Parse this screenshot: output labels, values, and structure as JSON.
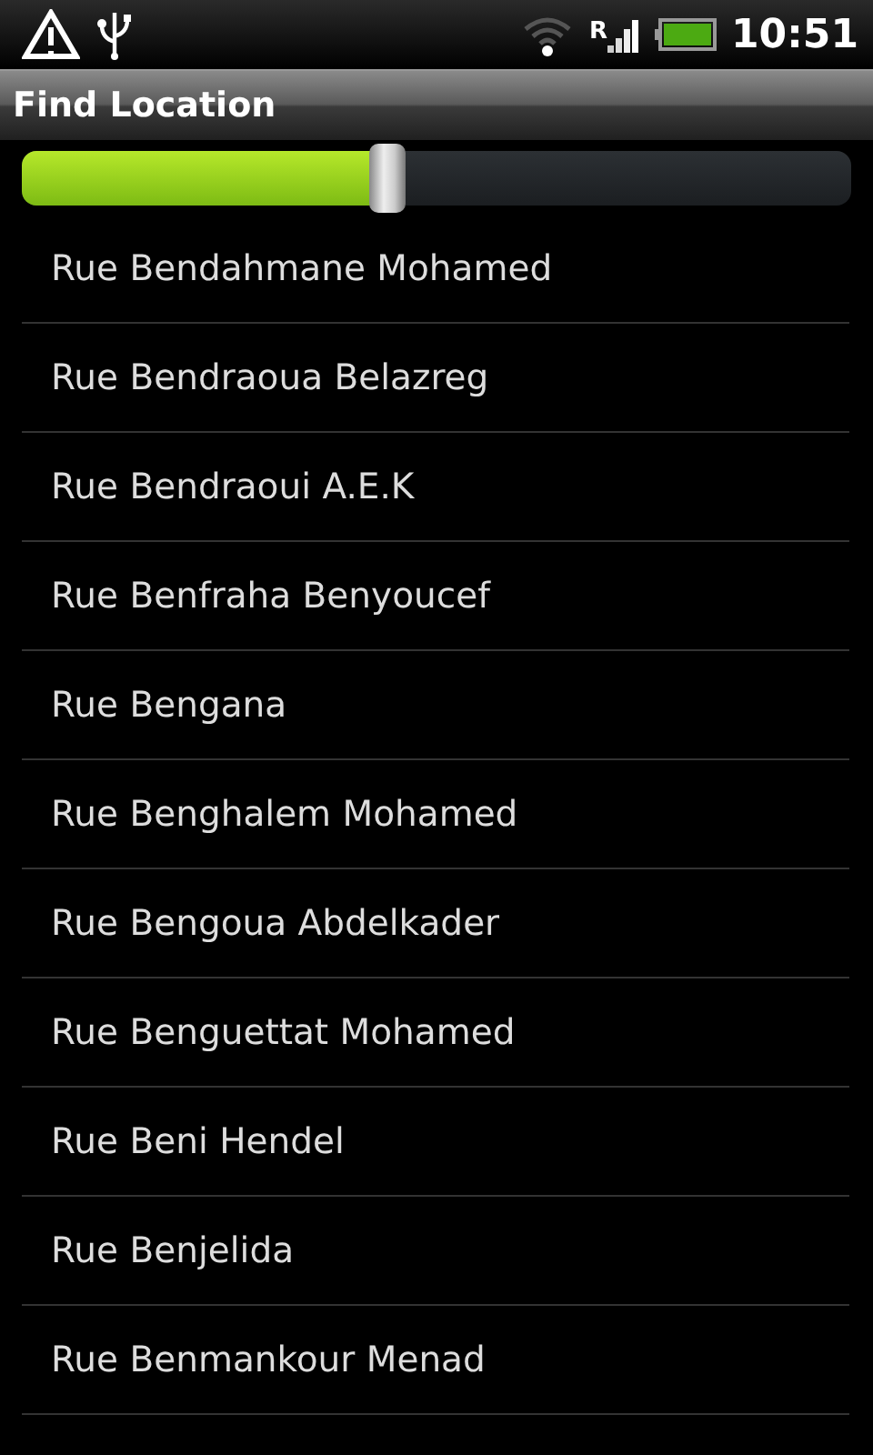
{
  "status_bar": {
    "roaming": "R",
    "time": "10:51"
  },
  "title_bar": {
    "title": "Find Location"
  },
  "slider": {
    "level": 0.44
  },
  "locations": [
    {
      "name": "Rue Bendahmane Mohamed"
    },
    {
      "name": "Rue Bendraoua Belazreg"
    },
    {
      "name": "Rue Bendraoui A.E.K"
    },
    {
      "name": "Rue Benfraha Benyoucef"
    },
    {
      "name": "Rue Bengana"
    },
    {
      "name": "Rue Benghalem Mohamed"
    },
    {
      "name": "Rue Bengoua Abdelkader"
    },
    {
      "name": "Rue Benguettat Mohamed"
    },
    {
      "name": "Rue Beni Hendel"
    },
    {
      "name": "Rue Benjelida"
    },
    {
      "name": "Rue Benmankour Menad"
    }
  ]
}
